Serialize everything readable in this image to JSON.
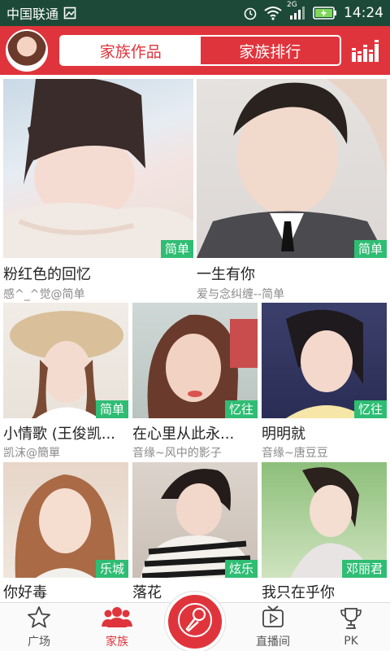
{
  "status_bar": {
    "carrier": "中国联通",
    "network": "2G",
    "time": "14:24"
  },
  "header": {
    "tabs": [
      {
        "label": "家族作品",
        "active": true
      },
      {
        "label": "家族排行",
        "active": false
      }
    ]
  },
  "works": [
    {
      "title": "粉红色的回忆",
      "author": "感^_^觉@简单",
      "badge": "简单"
    },
    {
      "title": "一生有你",
      "author": "爱与念纠缠--简单",
      "badge": "简单"
    },
    {
      "title": "小情歌 (王俊凯...",
      "author": "凯沫@簡單",
      "badge": "简单"
    },
    {
      "title": "在心里从此永...",
      "author": "音缘~风中的影子",
      "badge": "忆往"
    },
    {
      "title": "明明就",
      "author": "音缘~唐豆豆",
      "badge": "忆往"
    },
    {
      "title": "你好毒",
      "author": "",
      "badge": "乐城"
    },
    {
      "title": "落花",
      "author": "",
      "badge": "炫乐"
    },
    {
      "title": "我只在乎你",
      "author": "",
      "badge": "邓丽君"
    }
  ],
  "bottom_nav": {
    "items": [
      {
        "label": "广场",
        "icon": "star-icon",
        "active": false
      },
      {
        "label": "家族",
        "icon": "group-icon",
        "active": true
      },
      {
        "label": "",
        "icon": "microphone-icon",
        "active": false
      },
      {
        "label": "直播间",
        "icon": "live-icon",
        "active": false
      },
      {
        "label": "PK",
        "icon": "trophy-icon",
        "active": false
      }
    ]
  },
  "colors": {
    "accent": "#e0343c",
    "badge": "#2fbd74",
    "status_bar": "#1d4a38"
  }
}
